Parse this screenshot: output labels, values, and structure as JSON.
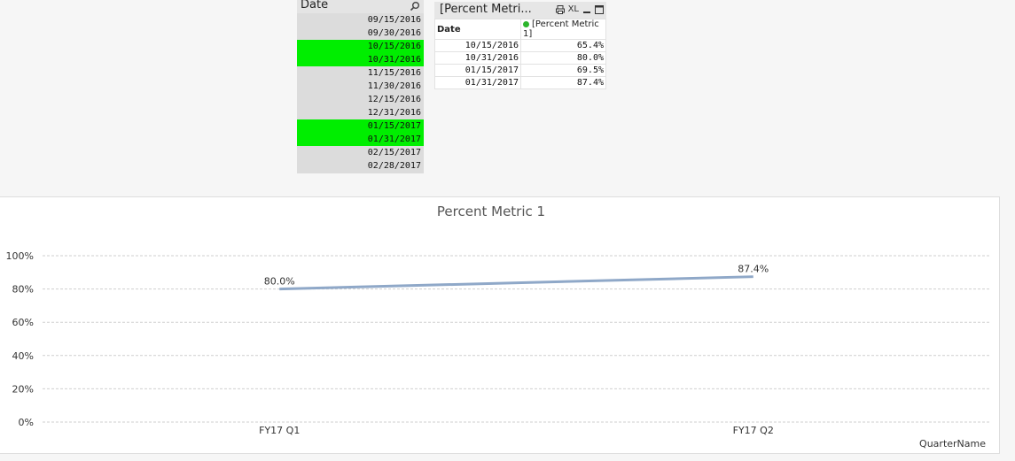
{
  "listbox": {
    "title": "Date",
    "search_icon": "search-icon",
    "items": [
      {
        "label": "09/15/2016",
        "selected": false
      },
      {
        "label": "09/30/2016",
        "selected": false
      },
      {
        "label": "10/15/2016",
        "selected": true
      },
      {
        "label": "10/31/2016",
        "selected": true
      },
      {
        "label": "11/15/2016",
        "selected": false
      },
      {
        "label": "11/30/2016",
        "selected": false
      },
      {
        "label": "12/15/2016",
        "selected": false
      },
      {
        "label": "12/31/2016",
        "selected": false
      },
      {
        "label": "01/15/2017",
        "selected": true
      },
      {
        "label": "01/31/2017",
        "selected": true
      },
      {
        "label": "02/15/2017",
        "selected": false
      },
      {
        "label": "02/28/2017",
        "selected": false
      }
    ],
    "colors": {
      "selected": "#00ee00",
      "unselected": "#dcdcdc"
    }
  },
  "tablebox": {
    "title": "[Percent Metri...",
    "icons": [
      "print-icon",
      "xl-icon",
      "minimize-icon",
      "maximize-icon"
    ],
    "icon_labels": {
      "xl": "XL"
    },
    "columns": [
      "Date",
      "[Percent Metric 1]"
    ],
    "rows": [
      [
        "10/15/2016",
        "65.4%"
      ],
      [
        "10/31/2016",
        "80.0%"
      ],
      [
        "01/15/2017",
        "69.5%"
      ],
      [
        "01/31/2017",
        "87.4%"
      ]
    ]
  },
  "chart_data": {
    "type": "line",
    "title": "Percent Metric 1",
    "xlabel": "QuarterName",
    "ylabel": "",
    "categories": [
      "FY17 Q1",
      "FY17 Q2"
    ],
    "series": [
      {
        "values": [
          80.0,
          87.4
        ],
        "data_labels": [
          "80.0%",
          "87.4%"
        ],
        "color": "#8fa8c8"
      }
    ],
    "yticks": [
      "0%",
      "20%",
      "40%",
      "60%",
      "80%",
      "100%"
    ],
    "ylim": [
      0,
      100
    ],
    "grid": true,
    "legend": "none"
  }
}
